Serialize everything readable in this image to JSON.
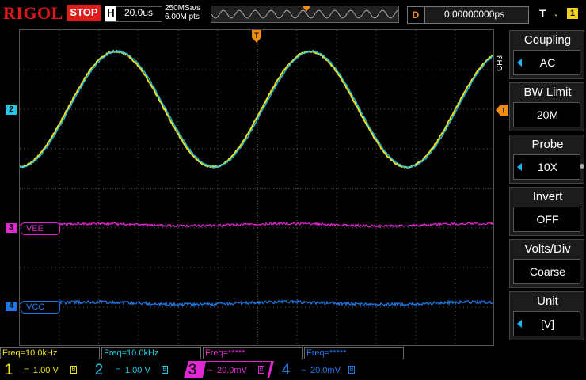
{
  "header": {
    "brand": "RIGOL",
    "run_state": "STOP",
    "horizontal_label": "H",
    "timebase": "20.0us",
    "sample_rate": "250MSa/s",
    "memory_depth": "6.00M pts",
    "delay_label": "D",
    "delay_value": "0.00000000ps",
    "trigger_label": "T",
    "trigger_edge_icon": "rising-edge-icon",
    "trigger_source": "1"
  },
  "menu": {
    "channel": "CH3",
    "items": [
      {
        "title": "Coupling",
        "value": "AC",
        "has_arrow": true
      },
      {
        "title": "BW Limit",
        "value": "20M",
        "has_arrow": false
      },
      {
        "title": "Probe",
        "value": "10X",
        "has_arrow": true
      },
      {
        "title": "Invert",
        "value": "OFF",
        "has_arrow": false
      },
      {
        "title": "Volts/Div",
        "value": "Coarse",
        "has_arrow": false
      },
      {
        "title": "Unit",
        "value": "[V]",
        "has_arrow": true
      }
    ]
  },
  "waveform_labels": {
    "ch2_marker": "2",
    "ch3_marker": "3",
    "ch4_marker": "4",
    "ch3_label": "VEE",
    "ch4_label": "VCC"
  },
  "frequency": {
    "ch1": "Freq=10.0kHz",
    "ch2": "Freq=10.0kHz",
    "ch3": "Freq=*****",
    "ch4": "Freq=*****"
  },
  "channels": [
    {
      "number": "1",
      "coupling_symbol": "=",
      "scale": "1.00 V",
      "color": "#f0e020"
    },
    {
      "number": "2",
      "coupling_symbol": "=",
      "scale": "1.00 V",
      "color": "#22c8e6"
    },
    {
      "number": "3",
      "coupling_symbol": "~",
      "scale": "20.0mV",
      "color": "#e028d0"
    },
    {
      "number": "4",
      "coupling_symbol": "~",
      "scale": "20.0mV",
      "color": "#1f78e6"
    }
  ],
  "colors": {
    "ch1": "#f0e020",
    "ch2": "#22c8e6",
    "ch3": "#e028d0",
    "ch4": "#1f78e6",
    "trigger": "#f08c14",
    "stop": "#e01d18"
  }
}
